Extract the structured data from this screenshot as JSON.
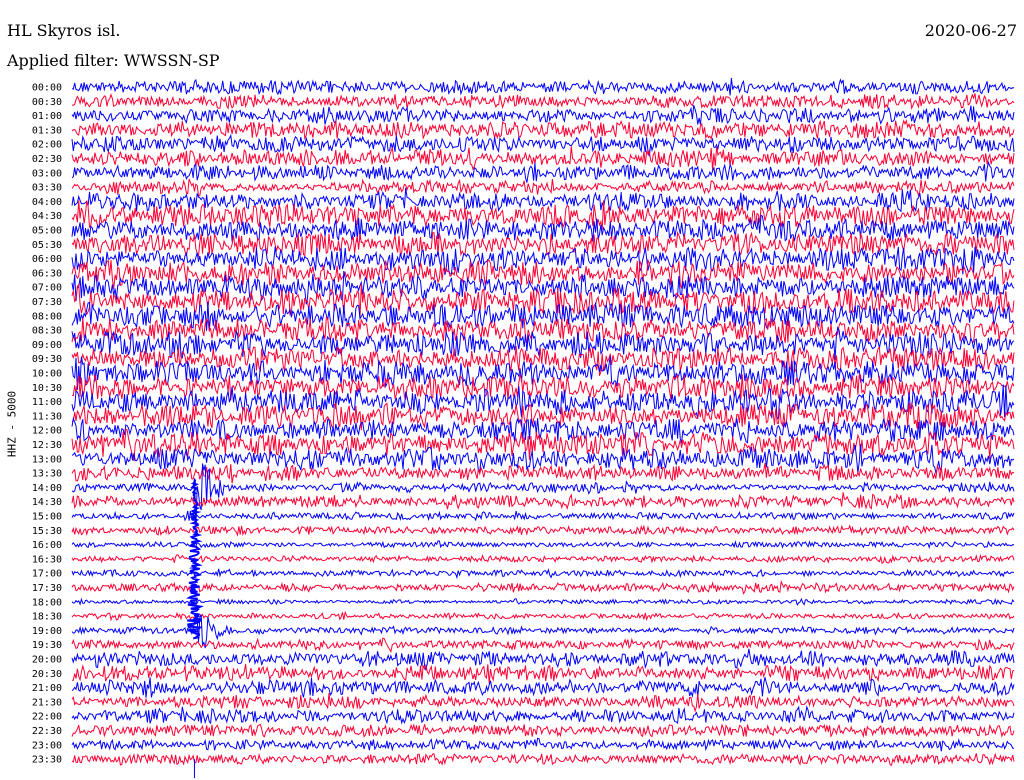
{
  "header": {
    "station": "HL Skyros isl.",
    "date": "2020-06-27",
    "filter": "Applied filter: WWSSN-SP",
    "channel": "HHZ - 5000"
  },
  "chart_data": {
    "type": "line",
    "title": "HL Skyros isl.",
    "subtitle": "Applied filter: WWSSN-SP",
    "ylabel": "HHZ - 5000",
    "row_labels": [
      "00:00",
      "00:30",
      "01:00",
      "01:30",
      "02:00",
      "02:30",
      "03:00",
      "03:30",
      "04:00",
      "04:30",
      "05:00",
      "05:30",
      "06:00",
      "06:30",
      "07:00",
      "07:30",
      "08:00",
      "08:30",
      "09:00",
      "09:30",
      "10:00",
      "10:30",
      "11:00",
      "11:30",
      "12:00",
      "12:30",
      "13:00",
      "13:30",
      "14:00",
      "14:30",
      "15:00",
      "15:30",
      "16:00",
      "16:30",
      "17:00",
      "17:30",
      "18:00",
      "18:30",
      "19:00",
      "19:30",
      "20:00",
      "20:30",
      "21:00",
      "21:30",
      "22:00",
      "22:30",
      "23:00",
      "23:30"
    ],
    "trace_colors": [
      "#0000ff",
      "#ff0033"
    ],
    "series": [
      {
        "values": [
          0.55,
          0.55,
          0.6,
          0.7,
          0.7,
          0.7,
          0.6,
          0.5,
          0.8,
          0.9,
          0.9,
          0.9,
          0.95,
          0.95,
          1.0,
          1.0,
          1.0,
          1.0,
          1.0,
          1.0,
          1.0,
          0.95,
          1.0,
          0.95,
          0.95,
          0.95,
          0.9,
          0.6,
          0.35,
          0.55,
          0.3,
          0.35,
          0.22,
          0.25,
          0.25,
          0.35,
          0.18,
          0.22,
          0.3,
          0.4,
          0.65,
          0.6,
          0.6,
          0.55,
          0.55,
          0.5,
          0.4,
          0.45
        ]
      }
    ],
    "events": [
      {
        "row": "14:00",
        "at_fraction": 0.13,
        "peak_amplitude": 5.0
      },
      {
        "row": "19:00",
        "at_fraction": 0.13,
        "peak_amplitude": 3.0
      }
    ],
    "grid": false
  }
}
